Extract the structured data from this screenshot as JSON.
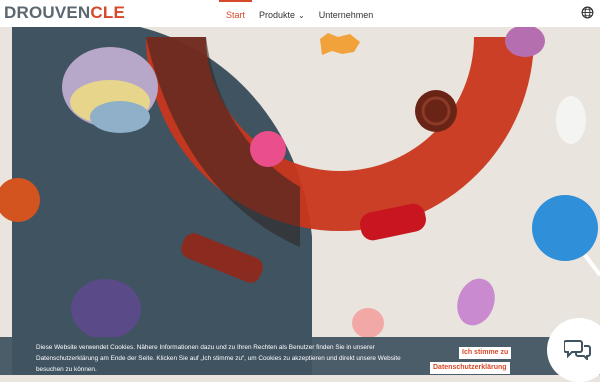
{
  "logo": {
    "part1": "DROUVEN",
    "part2": "CLE"
  },
  "nav": {
    "items": [
      {
        "label": "Start",
        "active": true
      },
      {
        "label": "Produkte",
        "has_dropdown": true
      },
      {
        "label": "Unternehmen"
      }
    ]
  },
  "icons": {
    "language": "globe-icon",
    "chat": "chat-bubbles-icon",
    "dropdown": "chevron-down-icon"
  },
  "colors": {
    "accent": "#d6492a",
    "slate": "#3f5361",
    "background": "#e9e4dd"
  },
  "cookie": {
    "text": "Diese Website verwendet Cookies. Nähere Informationen dazu und zu Ihren Rechten als Benutzer finden Sie in unserer Datenschutzerklärung am Ende der Seite. Klicken Sie auf „Ich stimme zu“, um Cookies zu akzeptieren und direkt unsere Website besuchen zu können.",
    "accept_label": "Ich stimme zu",
    "privacy_label": "Datenschutzerklärung"
  }
}
